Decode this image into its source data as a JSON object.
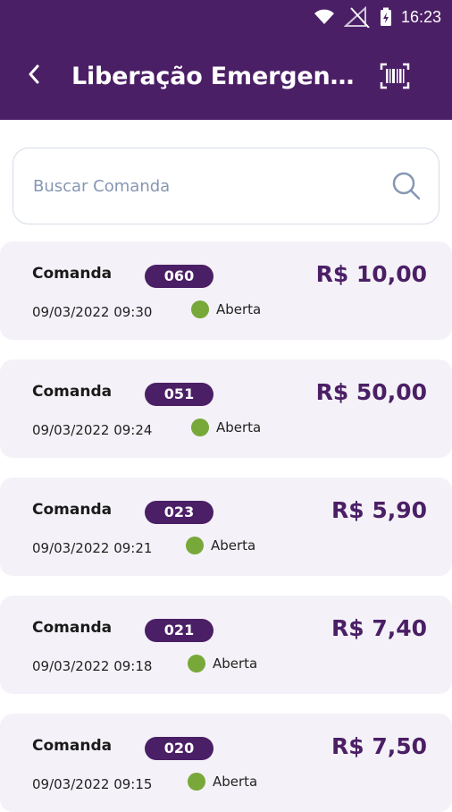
{
  "status_bar": {
    "time": "16:23"
  },
  "app_bar": {
    "title": "Liberação Emergen…"
  },
  "search": {
    "placeholder": "Buscar Comanda"
  },
  "comandas": [
    {
      "label": "Comanda",
      "number": "060",
      "date": "09/03/2022  09:30",
      "status": "Aberta",
      "price": "R$ 10,00"
    },
    {
      "label": "Comanda",
      "number": "051",
      "date": "09/03/2022  09:24",
      "status": "Aberta",
      "price": "R$ 50,00"
    },
    {
      "label": "Comanda",
      "number": "023",
      "date": "09/03/2022  09:21",
      "status": "Aberta",
      "price": "R$ 5,90"
    },
    {
      "label": "Comanda",
      "number": "021",
      "date": "09/03/2022  09:18",
      "status": "Aberta",
      "price": "R$ 7,40"
    },
    {
      "label": "Comanda",
      "number": "020",
      "date": "09/03/2022  09:15",
      "status": "Aberta",
      "price": "R$ 7,50"
    }
  ],
  "colors": {
    "primary": "#4b1f66",
    "card_bg": "#f4f2f8",
    "status_open": "#78a83a"
  },
  "icons": {
    "back": "chevron-left-icon",
    "barcode": "barcode-icon",
    "search": "search-icon",
    "wifi": "wifi-icon",
    "signal": "signal-icon",
    "battery": "battery-charging-icon"
  }
}
